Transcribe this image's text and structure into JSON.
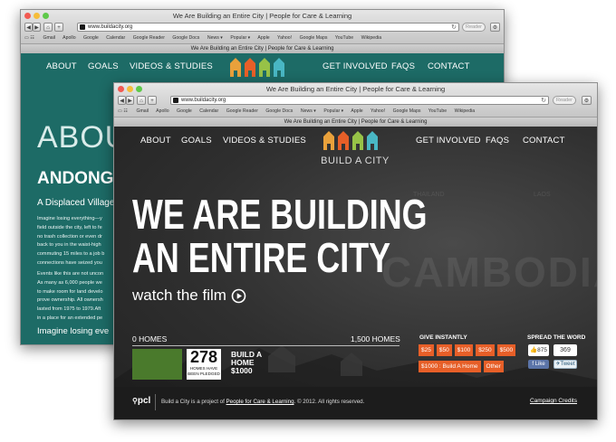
{
  "back_window": {
    "title": "We Are Building an Entire City | People for Care & Learning",
    "url": "www.buildacity.org",
    "reader_label": "Reader",
    "bookmarks": [
      "Gmail",
      "Apollo",
      "Google",
      "Calendar",
      "Google Reader",
      "Google Docs",
      "News ▾",
      "Popular ▾",
      "Apple",
      "Yahoo!",
      "Google Maps",
      "YouTube",
      "Wikipedia"
    ],
    "tab_title": "We Are Building an Entire City | People for Care & Learning",
    "nav": {
      "about": "ABOUT",
      "goals": "GOALS",
      "videos": "VIDEOS & STUDIES",
      "get_involved": "GET INVOLVED",
      "faqs": "FAQS",
      "contact": "CONTACT"
    },
    "heading_partial": "ABOU",
    "subheading_partial": "ANDONG",
    "tagline_partial": "A Displaced Village",
    "paragraph1": [
      "Imagine losing everything—y",
      "field outside the city, left to fe",
      "no trash collection or even dr",
      "back to you in the waist-high",
      "commuting 15 miles to a job b",
      "connections have seized you"
    ],
    "paragraph2": [
      "Events like this are not uncon",
      "As many as 6,000 people we",
      "to make room for land develo",
      "prove ownership. All ownersh",
      "lasted from 1975 to 1979.Aft",
      "in a place for an extended pe"
    ],
    "footer_partial": "Imagine losing eve"
  },
  "front_window": {
    "title": "We Are Building an Entire City | People for Care & Learning",
    "url": "www.buildacity.org",
    "reader_label": "Reader",
    "bookmarks": [
      "Gmail",
      "Apollo",
      "Google",
      "Calendar",
      "Google Reader",
      "Google Docs",
      "News ▾",
      "Popular ▾",
      "Apple",
      "Yahoo!",
      "Google Maps",
      "YouTube",
      "Wikipedia"
    ],
    "tab_title": "We Are Building an Entire City | People for Care & Learning",
    "nav": {
      "about": "ABOUT",
      "goals": "GOALS",
      "videos": "VIDEOS & STUDIES",
      "get_involved": "GET INVOLVED",
      "faqs": "FAQS",
      "contact": "CONTACT"
    },
    "logo_text": "BUILD A CITY",
    "hero_line1": "WE ARE BUILDING",
    "hero_line2": "AN ENTIRE CITY",
    "watch_film": "watch the film",
    "map_labels": {
      "country": "CAMBODIA",
      "thailand": "THAILAND",
      "laos": "LAOS"
    },
    "progress": {
      "start_label": "0 HOMES",
      "end_label": "1,500 HOMES",
      "pledged_fraction": 0.185
    },
    "pledged": {
      "count": "278",
      "label": "HOMES HAVE BEEN PLEDGED"
    },
    "build_cta": {
      "line1": "BUILD A",
      "line2": "HOME",
      "line3": "$1000"
    },
    "give": {
      "heading": "GIVE INSTANTLY",
      "amounts": [
        "$25",
        "$50",
        "$100",
        "$250",
        "$500"
      ],
      "home": "$1000 : Build A Home",
      "other": "Other"
    },
    "spread": {
      "heading": "SPREAD THE WORD",
      "like_count": "875",
      "like_label": "Like",
      "tweet_count": "369",
      "tweet_label": "Tweet"
    },
    "footer": {
      "logo": "pcl",
      "text_prefix": "Build a City is a project of ",
      "org_link": "People for Care & Learning",
      "text_suffix": ". © 2012. All rights reserved.",
      "credits": "Campaign Credits"
    }
  },
  "colors": {
    "teal": "#1d6b66",
    "dark": "#2b2b2b",
    "green_bar": "#4a7a2c",
    "orange": "#e75f28"
  }
}
